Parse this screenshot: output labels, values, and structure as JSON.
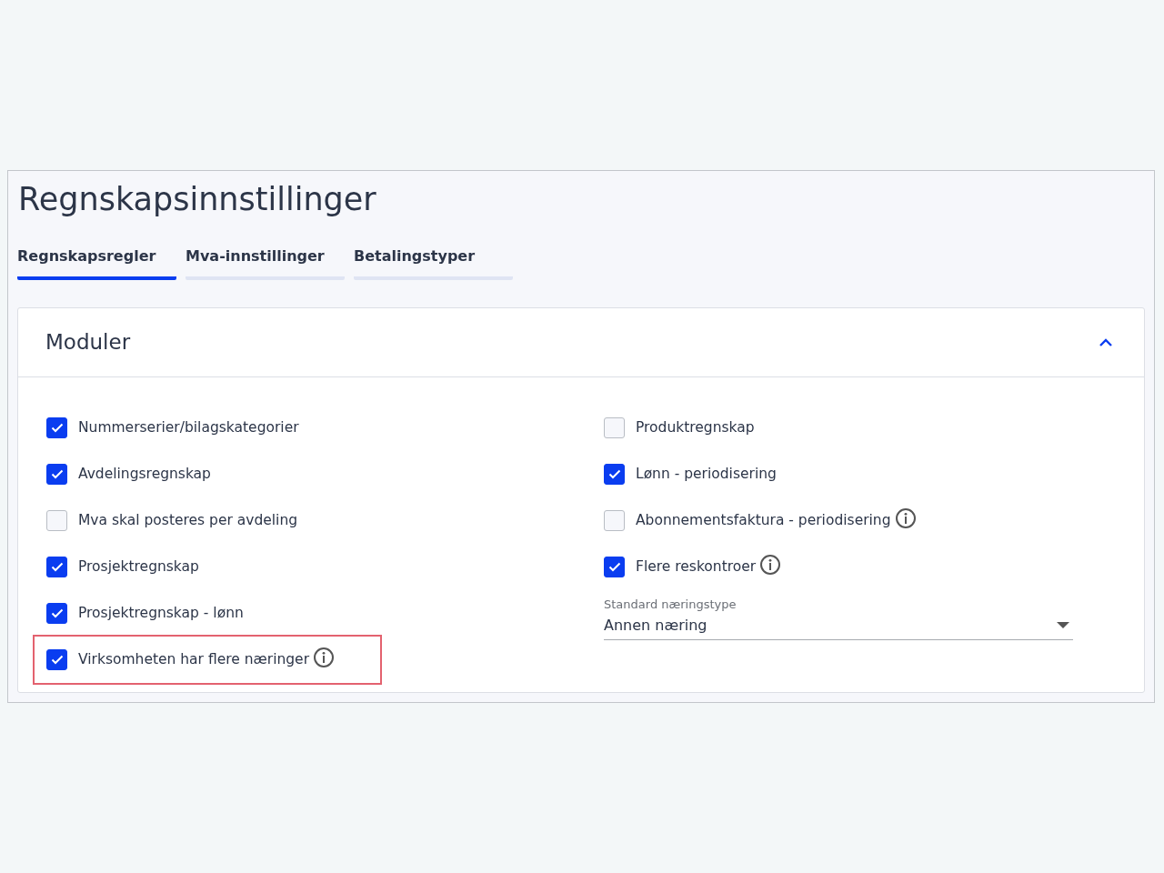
{
  "title": "Regnskapsinnstillinger",
  "tabs": [
    {
      "label": "Regnskapsregler",
      "selected": true
    },
    {
      "label": "Mva-innstillinger",
      "selected": false
    },
    {
      "label": "Betalingstyper",
      "selected": false
    }
  ],
  "section": {
    "title": "Moduler",
    "expanded": true,
    "left": [
      {
        "label": "Nummerserier/bilagskategorier",
        "checked": true,
        "info": false,
        "highlighted": false
      },
      {
        "label": "Avdelingsregnskap",
        "checked": true,
        "info": false,
        "highlighted": false
      },
      {
        "label": "Mva skal posteres per avdeling",
        "checked": false,
        "info": false,
        "highlighted": false
      },
      {
        "label": "Prosjektregnskap",
        "checked": true,
        "info": false,
        "highlighted": false
      },
      {
        "label": "Prosjektregnskap - lønn",
        "checked": true,
        "info": false,
        "highlighted": false
      },
      {
        "label": "Virksomheten har flere næringer",
        "checked": true,
        "info": true,
        "highlighted": true
      }
    ],
    "right": [
      {
        "label": "Produktregnskap",
        "checked": false,
        "info": false,
        "highlighted": false
      },
      {
        "label": "Lønn - periodisering",
        "checked": true,
        "info": false,
        "highlighted": false
      },
      {
        "label": "Abonnementsfaktura - periodisering",
        "checked": false,
        "info": true,
        "highlighted": false
      },
      {
        "label": "Flere reskontroer",
        "checked": true,
        "info": true,
        "highlighted": false
      }
    ],
    "select": {
      "label": "Standard næringstype",
      "value": "Annen næring"
    }
  }
}
